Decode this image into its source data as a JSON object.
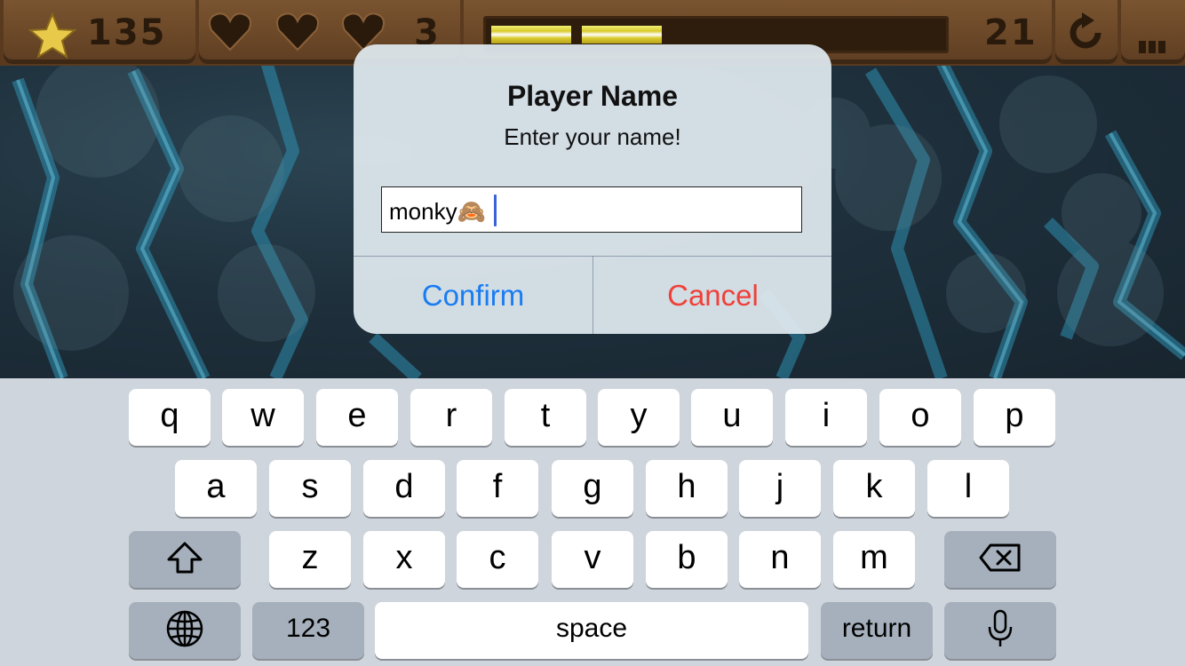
{
  "hud": {
    "stars": "135",
    "lives": "3",
    "progress_fraction": 0.39,
    "level": "21",
    "star_icon": "star-icon",
    "heart_icon": "heart-icon",
    "restart_icon": "restart-icon",
    "menu_icon": "menu-icon"
  },
  "alert": {
    "title": "Player Name",
    "message": "Enter your name!",
    "input_value": "monky🙈",
    "confirm_label": "Confirm",
    "cancel_label": "Cancel",
    "confirm_color": "#1a7cf2",
    "cancel_color": "#f0403a"
  },
  "keyboard": {
    "row1": [
      "q",
      "w",
      "e",
      "r",
      "t",
      "y",
      "u",
      "i",
      "o",
      "p"
    ],
    "row2": [
      "a",
      "s",
      "d",
      "f",
      "g",
      "h",
      "j",
      "k",
      "l"
    ],
    "row3": [
      "z",
      "x",
      "c",
      "v",
      "b",
      "n",
      "m"
    ],
    "numbers_label": "123",
    "space_label": "space",
    "return_label": "return",
    "shift_icon": "shift-icon",
    "backspace_icon": "backspace-icon",
    "globe_icon": "globe-icon",
    "mic_icon": "microphone-icon"
  }
}
